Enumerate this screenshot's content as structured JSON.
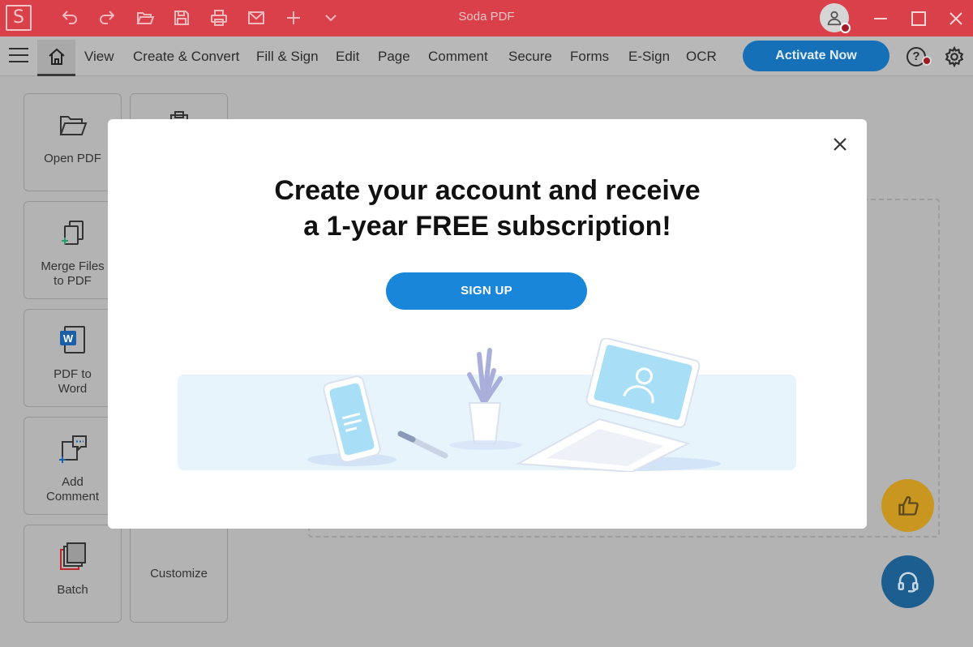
{
  "app": {
    "logo_letter": "S",
    "title": "Soda PDF"
  },
  "quick_access": [
    "undo-icon",
    "redo-icon",
    "open-folder-icon",
    "save-icon",
    "print-icon",
    "mail-icon",
    "plus-icon",
    "chevron-down-icon"
  ],
  "menu": {
    "items": [
      "View",
      "Create & Convert",
      "Fill & Sign",
      "Edit",
      "Page",
      "Comment",
      "Secure",
      "Forms",
      "E-Sign",
      "OCR"
    ],
    "activate_label": "Activate Now",
    "help_label": "?"
  },
  "tiles": [
    {
      "label": "Open PDF",
      "icon": "open-folder-icon"
    },
    {
      "label": "Merge Files\nto PDF",
      "icon": "merge-files-icon"
    },
    {
      "label": "PDF to\nWord",
      "icon": "word-icon"
    },
    {
      "label": "Add\nComment",
      "icon": "comment-icon"
    },
    {
      "label": "Batch",
      "icon": "batch-icon"
    },
    {
      "label": "Customize",
      "icon": ""
    }
  ],
  "modal": {
    "headline_line1": "Create your account and receive",
    "headline_line2": "a 1-year FREE subscription!",
    "signup_label": "SIGN UP"
  },
  "colors": {
    "titlebar": "#d9404a",
    "accent_blue": "#1a86d9",
    "activate_blue": "#1570b8",
    "like_gold": "#c9961f",
    "support_blue": "#1b5e8f"
  }
}
